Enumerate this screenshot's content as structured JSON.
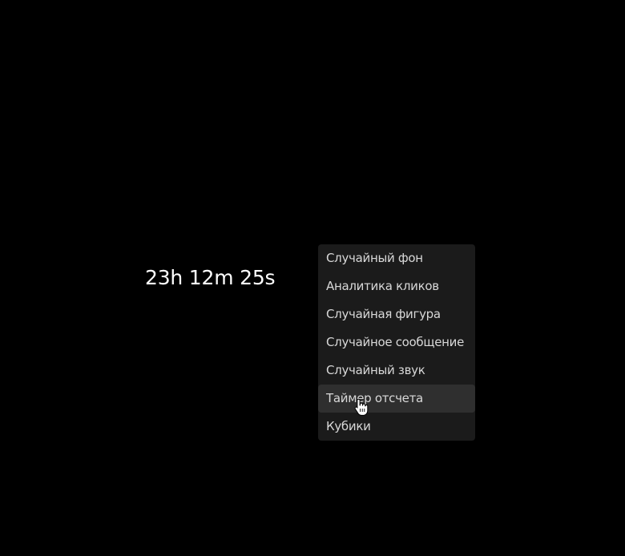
{
  "timer": {
    "text": "23h 12m 25s"
  },
  "menu": {
    "items": [
      {
        "label": "Случайный фон",
        "hovered": false
      },
      {
        "label": "Аналитика кликов",
        "hovered": false
      },
      {
        "label": "Случайная фигура",
        "hovered": false
      },
      {
        "label": "Случайное сообщение",
        "hovered": false
      },
      {
        "label": "Случайный звук",
        "hovered": false
      },
      {
        "label": "Таймер отсчета",
        "hovered": true
      },
      {
        "label": "Кубики",
        "hovered": false
      }
    ]
  },
  "colors": {
    "background": "#000000",
    "text": "#ffffff",
    "menu_bg": "#1b1b1b",
    "menu_hover_bg": "#2f2f2f",
    "menu_text": "#d8d8d8"
  },
  "cursor": {
    "icon": "hand-pointer-icon"
  }
}
